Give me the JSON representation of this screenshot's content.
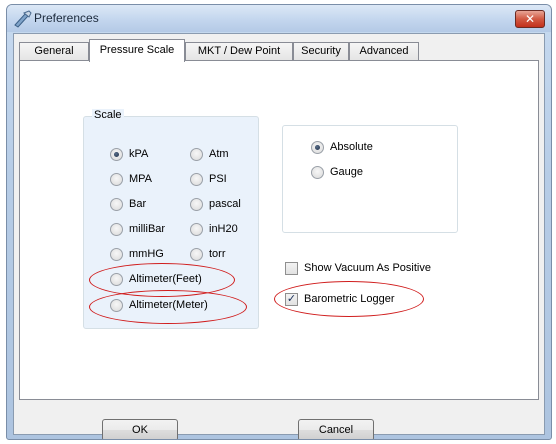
{
  "window": {
    "title": "Preferences",
    "close_symbol": "✕"
  },
  "tabs": [
    {
      "label": "General",
      "active": false
    },
    {
      "label": "Pressure Scale",
      "active": true
    },
    {
      "label": "MKT / Dew Point",
      "active": false
    },
    {
      "label": "Security",
      "active": false
    },
    {
      "label": "Advanced",
      "active": false
    }
  ],
  "scale_group": {
    "legend": "Scale",
    "left_column": [
      {
        "label": "kPA",
        "selected": true
      },
      {
        "label": "MPA",
        "selected": false
      },
      {
        "label": "Bar",
        "selected": false
      },
      {
        "label": "milliBar",
        "selected": false
      },
      {
        "label": "mmHG",
        "selected": false
      },
      {
        "label": "Altimeter(Feet)",
        "selected": false
      },
      {
        "label": "Altimeter(Meter)",
        "selected": false
      }
    ],
    "right_column": [
      {
        "label": "Atm",
        "selected": false
      },
      {
        "label": "PSI",
        "selected": false
      },
      {
        "label": "pascal",
        "selected": false
      },
      {
        "label": "inH20",
        "selected": false
      },
      {
        "label": "torr",
        "selected": false
      }
    ]
  },
  "mode_group": {
    "options": [
      {
        "label": "Absolute",
        "selected": true
      },
      {
        "label": "Gauge",
        "selected": false
      }
    ]
  },
  "checkboxes": {
    "show_vacuum": {
      "label": "Show Vacuum As Positive",
      "checked": false
    },
    "barometric_logger": {
      "label": "Barometric Logger",
      "checked": true,
      "check_glyph": "✓"
    }
  },
  "buttons": {
    "ok": "OK",
    "cancel": "Cancel"
  },
  "colors": {
    "highlight_ellipse": "#d01d1d",
    "group_bg": "#eaf2fb"
  }
}
